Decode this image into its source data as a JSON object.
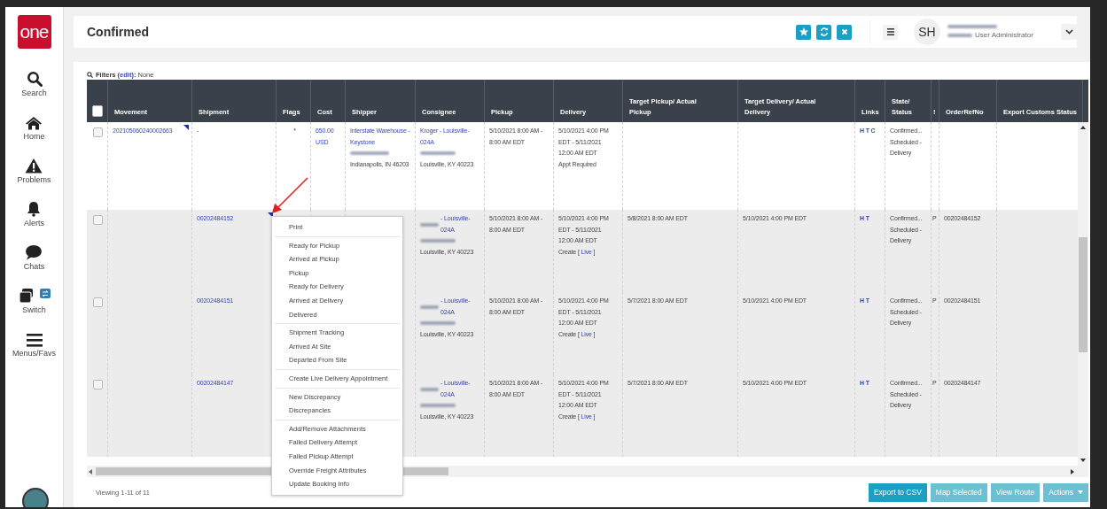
{
  "sidebar": {
    "logo": "one",
    "items": [
      {
        "kind": "search",
        "label": "Search"
      },
      {
        "kind": "home",
        "label": "Home"
      },
      {
        "kind": "problems",
        "label": "Problems"
      },
      {
        "kind": "alerts",
        "label": "Alerts"
      },
      {
        "kind": "chats",
        "label": "Chats"
      },
      {
        "kind": "switch",
        "label": "Switch"
      },
      {
        "kind": "menus",
        "label": "Menus/Favs"
      }
    ]
  },
  "header": {
    "title": "Confirmed",
    "actions": [
      {
        "kind": "star"
      },
      {
        "kind": "refresh"
      },
      {
        "kind": "close"
      }
    ],
    "user": {
      "initials": "SH",
      "role": "User Administrator"
    }
  },
  "filters": {
    "label": "Filters",
    "link": "(edit):",
    "value": "None"
  },
  "table": {
    "select_all_checked": false,
    "columns": [
      "Movement",
      "Shipment",
      "Flags",
      "Cost",
      "Shipper",
      "Consignee",
      "Pickup",
      "Delivery",
      "Target Pickup/ Actual Pickup",
      "Target Delivery/ Actual Delivery",
      "Links",
      "State/ Status",
      "!",
      "OrderRefNo",
      "Export Customs Status"
    ],
    "rows": [
      {
        "highlighted": false,
        "checked": false,
        "movement": "202105060240002663",
        "movement_marker": true,
        "shipment": "-",
        "shipment_link": false,
        "shipment_marker": false,
        "flags": "*",
        "cost": "650.00 USD",
        "shipper": {
          "link": "Interstate Warehouse - Keystone",
          "place": "Indianapolis, IN 46203"
        },
        "consignee": {
          "link": "Kroger - Louisville-024A",
          "redacted_prefix": false,
          "address": "Louisville, KY 40223"
        },
        "pickup": "5/10/2021 8:00 AM - 8:00 AM EDT",
        "delivery": {
          "window": "5/10/2021 4:00 PM EDT - 5/11/2021 12:00 AM EDT",
          "kind": "note",
          "text": "Appt Required"
        },
        "links": "H T C",
        "state": "Confirmed... Scheduled - Delivery"
      },
      {
        "highlighted": true,
        "checked": false,
        "movement_marker": false,
        "shipment": "00202484152",
        "shipment_link": true,
        "shipment_marker": true,
        "consignee": {
          "link": "- Louisville-024A",
          "redacted_prefix": true,
          "address": "Louisville, KY 40223"
        },
        "pickup": "5/10/2021 8:00 AM - 8:00 AM EDT",
        "delivery": {
          "window": "5/10/2021 4:00 PM EDT - 5/11/2021 12:00 AM EDT",
          "kind": "action",
          "text": "Create [",
          "link": "Live",
          "after": "]"
        },
        "target_pickup": "5/8/2021 8:00 AM EDT",
        "target_delivery": "5/10/2021 4:00 PM EDT",
        "links": "H T",
        "state": "Confirmed... Scheduled - Delivery",
        "excl": "P",
        "order_ref": "00202484152"
      },
      {
        "highlighted": true,
        "checked": false,
        "movement_marker": false,
        "shipment": "00202484151",
        "shipment_link": true,
        "shipment_marker": false,
        "consignee": {
          "link": "- Louisville-024A",
          "redacted_prefix": true,
          "address": "Louisville, KY 40223"
        },
        "pickup": "5/10/2021 8:00 AM - 8:00 AM EDT",
        "delivery": {
          "window": "5/10/2021 4:00 PM EDT - 5/11/2021 12:00 AM EDT",
          "kind": "action",
          "text": "Create [",
          "link": "Live",
          "after": "]"
        },
        "target_pickup": "5/7/2021 8:00 AM EDT",
        "target_delivery": "5/10/2021 4:00 PM EDT",
        "links": "H T",
        "state": "Confirmed... Scheduled - Delivery",
        "excl": "P",
        "order_ref": "00202484151"
      },
      {
        "highlighted": true,
        "checked": false,
        "movement_marker": false,
        "shipment": "00202484147",
        "shipment_link": true,
        "shipment_marker": false,
        "consignee": {
          "link": "- Louisville-024A",
          "redacted_prefix": true,
          "address": "Louisville, KY 40223"
        },
        "pickup": "5/10/2021 8:00 AM - 8:00 AM EDT",
        "delivery": {
          "window": "5/10/2021 4:00 PM EDT - 5/11/2021 12:00 AM EDT",
          "kind": "action",
          "text": "Create [",
          "link": "Live",
          "after": "]"
        },
        "target_pickup": "5/7/2021 8:00 AM EDT",
        "target_delivery": "5/10/2021 4:00 PM EDT",
        "links": "H T",
        "state": "Confirmed... Scheduled - Delivery",
        "excl": "P",
        "order_ref": "00202484147"
      }
    ]
  },
  "context_menu": {
    "groups": [
      [
        "Print"
      ],
      [
        "Ready for Pickup",
        "Arrived at Pickup",
        "Pickup",
        "Ready for Delivery",
        "Arrived at Delivery",
        "Delivered"
      ],
      [
        "Shipment Tracking",
        "Arrived At Site",
        "Departed From Site"
      ],
      [
        "Create Live Delivery Appointment"
      ],
      [
        "New Discrepancy",
        "Discrepancies"
      ],
      [
        "Add/Remove Attachments",
        "Failed Delivery Attempt",
        "Failed Pickup Attempt",
        "Override Freight Attributes",
        "Update Booking Info"
      ]
    ]
  },
  "footer": {
    "viewing": "Viewing 1-11 of 11",
    "buttons": [
      {
        "label": "Export to CSV",
        "primary": true,
        "caret": false
      },
      {
        "label": "Map Selected",
        "primary": false,
        "caret": false
      },
      {
        "label": "View Route",
        "primary": false,
        "caret": false
      },
      {
        "label": "Actions",
        "primary": false,
        "caret": true
      }
    ]
  }
}
